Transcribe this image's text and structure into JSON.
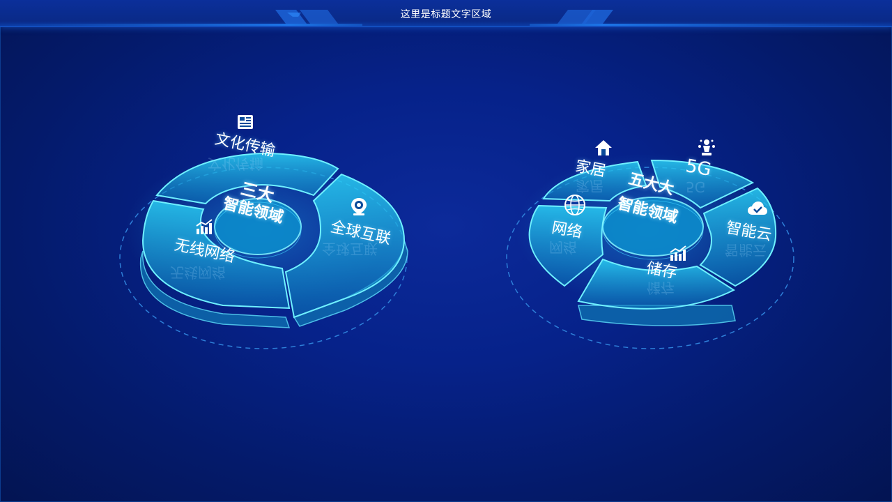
{
  "header": {
    "title": "这里是标题文字区域"
  },
  "left_diagram": {
    "center_line1": "三大",
    "center_line2": "智能领域",
    "segments": [
      {
        "label": "文化传输",
        "icon": "newspaper-icon"
      },
      {
        "label": "全球互联",
        "icon": "location-pin-icon"
      },
      {
        "label": "无线网络",
        "icon": "bar-chart-icon"
      }
    ]
  },
  "right_diagram": {
    "center_line1": "五大大",
    "center_line2": "智能领域",
    "segments": [
      {
        "label": "家居",
        "icon": "home-icon"
      },
      {
        "label": "5G",
        "icon": "chess-piece-icon"
      },
      {
        "label": "智能云",
        "icon": "cloud-check-icon"
      },
      {
        "label": "储存",
        "icon": "bar-chart-icon"
      },
      {
        "label": "网络",
        "icon": "globe-icon"
      }
    ]
  },
  "colors": {
    "background": "#06228a",
    "header": "#0a2a88",
    "segment_fill": "#19b6e6",
    "segment_edge": "#5ee6ff",
    "dashed_ring": "#2e7fd8"
  }
}
